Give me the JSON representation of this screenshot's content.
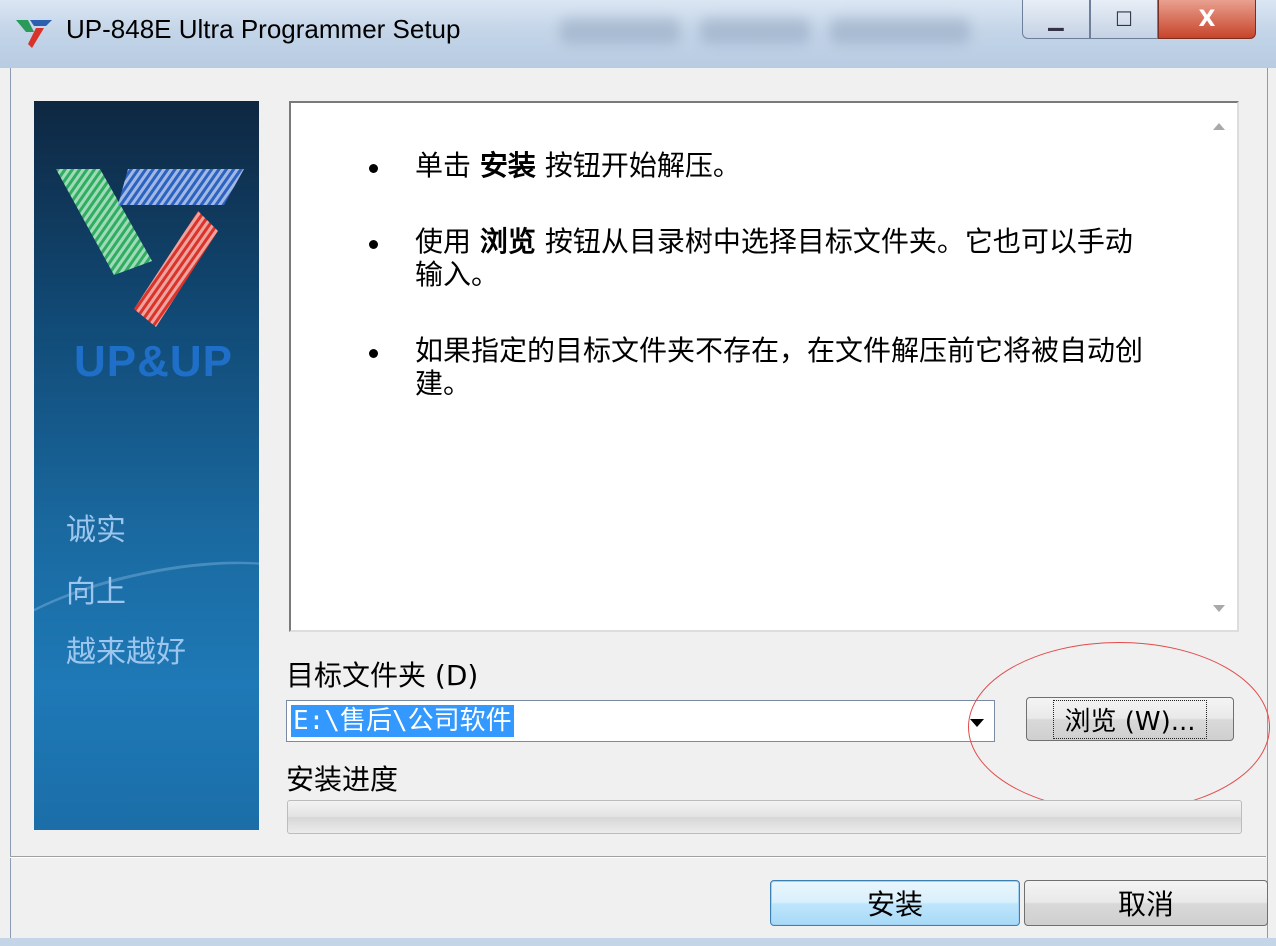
{
  "window": {
    "title": "UP-848E Ultra Programmer Setup",
    "minimize_symbol": "▁",
    "maximize_symbol": "☐",
    "close_symbol": "X"
  },
  "banner": {
    "brand": "UP&UP",
    "slogans": [
      "诚实",
      "向上",
      "越来越好"
    ]
  },
  "instructions": {
    "items": [
      {
        "before": "单击 ",
        "bold": "安装",
        "after": " 按钮开始解压。"
      },
      {
        "before": "使用 ",
        "bold": "浏览",
        "after": " 按钮从目录树中选择目标文件夹。它也可以手动输入。"
      },
      {
        "before": "",
        "bold": "",
        "after": "如果指定的目标文件夹不存在，在文件解压前它将被自动创建。"
      }
    ]
  },
  "folder": {
    "label": "目标文件夹 (D)",
    "value": "E:\\售后\\公司软件",
    "browse_label": "浏览 (W)..."
  },
  "progress": {
    "label": "安装进度",
    "value": 0
  },
  "buttons": {
    "install": "安装",
    "cancel": "取消"
  },
  "colors": {
    "selection": "#3399ff",
    "annotation_ring": "#e24b4b",
    "banner_top": "#0e2741",
    "banner_bottom": "#1e79b6"
  }
}
